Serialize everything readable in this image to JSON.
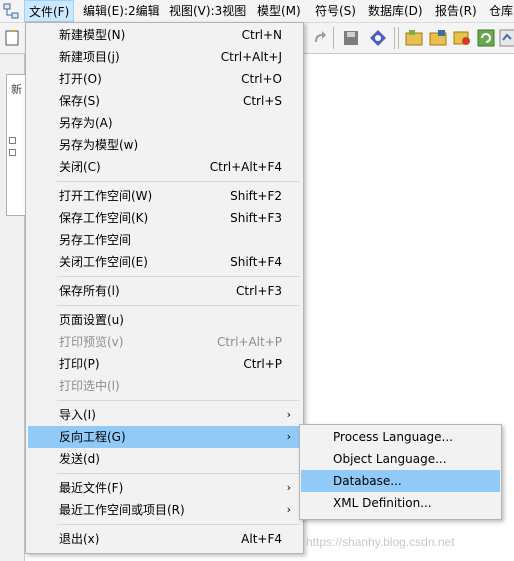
{
  "menubar": {
    "items": [
      {
        "label": "文件(F)"
      },
      {
        "label": "编辑(E):2编辑"
      },
      {
        "label": "视图(V):3视图"
      },
      {
        "label": "模型(M)"
      },
      {
        "label": "符号(S)"
      },
      {
        "label": "数据库(D)"
      },
      {
        "label": "报告(R)"
      },
      {
        "label": "仓库"
      }
    ]
  },
  "left_panel": {
    "tab_text": "新"
  },
  "file_menu": {
    "items": [
      {
        "label": "新建模型(N)",
        "shortcut": "Ctrl+N"
      },
      {
        "label": "新建项目(j)",
        "shortcut": "Ctrl+Alt+J"
      },
      {
        "label": "打开(O)",
        "shortcut": "Ctrl+O"
      },
      {
        "label": "保存(S)",
        "shortcut": "Ctrl+S"
      },
      {
        "label": "另存为(A)",
        "shortcut": ""
      },
      {
        "label": "另存为模型(w)",
        "shortcut": ""
      },
      {
        "label": "关闭(C)",
        "shortcut": "Ctrl+Alt+F4"
      },
      {
        "label": "打开工作空间(W)",
        "shortcut": "Shift+F2"
      },
      {
        "label": "保存工作空间(K)",
        "shortcut": "Shift+F3"
      },
      {
        "label": "另存工作空间",
        "shortcut": ""
      },
      {
        "label": "关闭工作空间(E)",
        "shortcut": "Shift+F4"
      },
      {
        "label": "保存所有(l)",
        "shortcut": "Ctrl+F3"
      },
      {
        "label": "页面设置(u)",
        "shortcut": ""
      },
      {
        "label": "打印预览(v)",
        "shortcut": "Ctrl+Alt+P",
        "disabled": true
      },
      {
        "label": "打印(P)",
        "shortcut": "Ctrl+P"
      },
      {
        "label": "打印选中(l)",
        "shortcut": "",
        "disabled": true
      },
      {
        "label": "导入(I)",
        "shortcut": "",
        "submenu": true
      },
      {
        "label": "反向工程(G)",
        "shortcut": "",
        "submenu": true,
        "selected": true
      },
      {
        "label": "发送(d)",
        "shortcut": ""
      },
      {
        "label": "最近文件(F)",
        "shortcut": "",
        "submenu": true
      },
      {
        "label": "最近工作空间或项目(R)",
        "shortcut": "",
        "submenu": true
      },
      {
        "label": "退出(x)",
        "shortcut": "Alt+F4"
      }
    ]
  },
  "reverse_engineer_submenu": {
    "items": [
      {
        "label": "Process Language..."
      },
      {
        "label": "Object Language..."
      },
      {
        "label": "Database...",
        "selected": true
      },
      {
        "label": "XML Definition..."
      }
    ]
  },
  "watermark": "https://shanhy.blog.csdn.net",
  "colors": {
    "menu_bg": "#f2f2f2",
    "selection": "#91c9f7",
    "active_menubar": "#cce8ff",
    "disabled_text": "#8d8d8d"
  },
  "icons": {
    "arrow": "›"
  }
}
